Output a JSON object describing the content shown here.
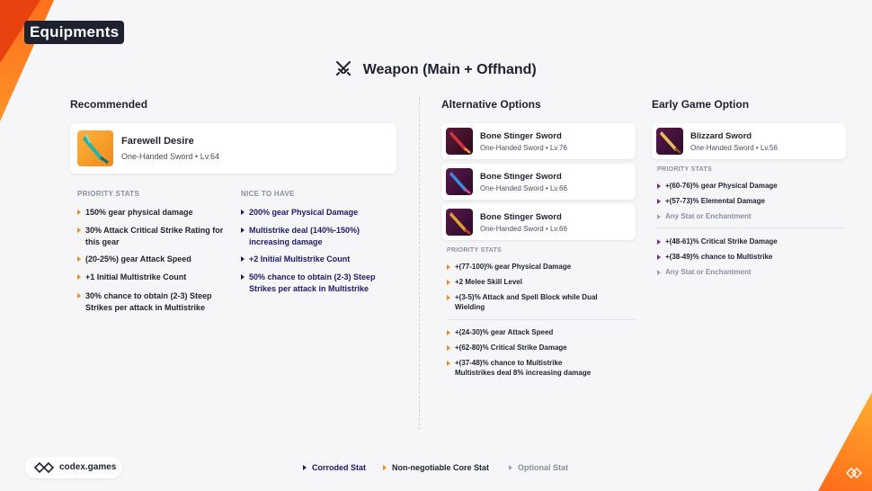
{
  "header": {
    "title": "Equipments",
    "section_title": "Weapon (Main + Offhand)"
  },
  "recommended": {
    "heading": "Recommended",
    "item": {
      "name": "Farewell Desire",
      "sub": "One-Handed Sword  •  Lv.64"
    },
    "priority_label": "PRIORITY STATS",
    "priority": [
      "150% gear physical damage",
      "30% Attack Critical Strike Rating for this gear",
      "(20-25%) gear Attack Speed",
      "+1 Initial Multistrike Count",
      "30% chance to obtain (2-3) Steep Strikes per attack in Multistrike"
    ],
    "nice_label": "NICE TO HAVE",
    "nice": [
      "200% gear Physical Damage",
      "Multistrike deal (140%-150%) increasing damage",
      "+2 Initial Multistrike Count",
      "50% chance to obtain (2-3) Steep Strikes per attack in Multistrike"
    ]
  },
  "alternative": {
    "heading": "Alternative Options",
    "items": [
      {
        "name": "Bone Stinger Sword",
        "sub": "One-Handed Sword  •  Lv.76"
      },
      {
        "name": "Bone Stinger Sword",
        "sub": "One-Handed Sword  •  Lv.66"
      },
      {
        "name": "Bone Stinger Sword",
        "sub": "One-Handed Sword  •  Lv.66"
      }
    ],
    "priority_label": "PRIORITY STATS",
    "group1": [
      "+(77-100)% gear Physical Damage",
      "+2 Melee Skill Level",
      "+(3-5)% Attack and Spell Block while Dual Wielding"
    ],
    "group2": [
      "+(24-30)% gear Attack Speed",
      "+(62-80)% Critical Strike Damage",
      "+(37-48)% chance to Multistrike Multistrikes deal 8% increasing damage"
    ]
  },
  "early": {
    "heading": "Early Game Option",
    "item": {
      "name": "Blizzard Sword",
      "sub": "One-Handed Sword  •  Lv.56"
    },
    "priority_label": "PRIORITY STATS",
    "group1": [
      "+(60-76)% gear Physical Damage",
      "+(57-73)% Elemental Damage",
      "Any Stat or Enchantment"
    ],
    "group2": [
      "+(48-61)% Critical Strike Damage",
      "+(38-49)% chance to Multistrike",
      "Any Stat or Enchantment"
    ]
  },
  "footer": {
    "brand": "codex.games",
    "legend": {
      "corroded": "Corroded Stat",
      "core": "Non-negotiable Core Stat",
      "optional": "Optional Stat"
    }
  },
  "colors": {
    "accent_orange": "#f08a1c",
    "corroded_navy": "#1e1a6e",
    "purple": "#7a2a8a",
    "optional_gray": "#8a8fa0"
  }
}
